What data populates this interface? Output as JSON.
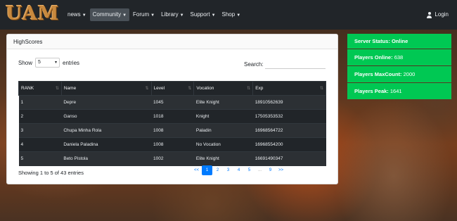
{
  "brand": {
    "logo_text": "UAM"
  },
  "nav": {
    "items": [
      {
        "label": "news",
        "active": false
      },
      {
        "label": "Community",
        "active": true
      },
      {
        "label": "Forum",
        "active": false
      },
      {
        "label": "Library",
        "active": false
      },
      {
        "label": "Support",
        "active": false
      },
      {
        "label": "Shop",
        "active": false
      }
    ],
    "login_label": "Login"
  },
  "highscores": {
    "title": "HighScores",
    "show_label": "Show",
    "entries_value": "5",
    "entries_label": "entries",
    "search_label": "Search:",
    "search_value": "",
    "columns": [
      "RANK",
      "Name",
      "Level",
      "Vocation",
      "Exp"
    ],
    "rows": [
      {
        "rank": "1",
        "name": "Depre",
        "level": "1045",
        "vocation": "Elite Knight",
        "exp": "18910562639"
      },
      {
        "rank": "2",
        "name": "Ganso",
        "level": "1018",
        "vocation": "Knight",
        "exp": "17505353532"
      },
      {
        "rank": "3",
        "name": "Chupa Minha Rola",
        "level": "1008",
        "vocation": "Paladin",
        "exp": "16968564722"
      },
      {
        "rank": "4",
        "name": "Daniela Paladina",
        "level": "1008",
        "vocation": "No Vocation",
        "exp": "16968554200"
      },
      {
        "rank": "5",
        "name": "Beto Pistola",
        "level": "1002",
        "vocation": "Elite Knight",
        "exp": "16691490347"
      }
    ],
    "info_text": "Showing 1 to 5 of 43 entries",
    "pagination": [
      "<<",
      "1",
      "2",
      "3",
      "4",
      "5",
      "...",
      "9",
      ">>"
    ],
    "current_page": "1"
  },
  "server": {
    "status_label": "Server Status:",
    "status_value": "Online",
    "players_online_label": "Players Online:",
    "players_online_value": "638",
    "max_count_label": "Players MaxCount:",
    "max_count_value": "2000",
    "peak_label": "Players Peak:",
    "peak_value": "1641",
    "color": "#00c853"
  }
}
